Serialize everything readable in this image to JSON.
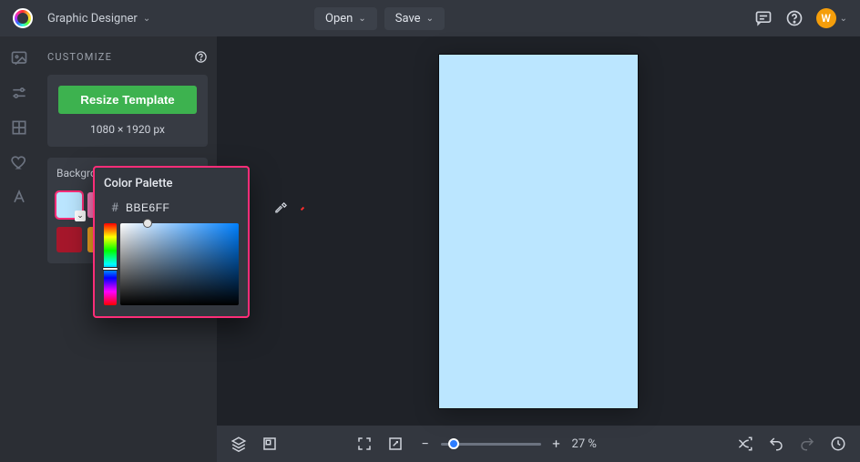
{
  "header": {
    "title": "Graphic Designer",
    "open_label": "Open",
    "save_label": "Save",
    "avatar_letter": "W"
  },
  "rail": {
    "items": [
      "image-icon",
      "sliders-icon",
      "grid-icon",
      "heart-icon",
      "text-icon"
    ]
  },
  "customize": {
    "title": "CUSTOMIZE",
    "resize_label": "Resize Template",
    "dimensions": "1080 × 1920 px",
    "bg_label": "Background Color",
    "swatches_row1": [
      "#bbe6ff",
      "#ff7fbf",
      "#6bbf6b"
    ],
    "swatches_row2": [
      "#a6172b",
      "#f5a623"
    ]
  },
  "palette": {
    "title": "Color Palette",
    "hex": "BBE6FF",
    "current_color": "#bbe6ff"
  },
  "canvas": {
    "artboard_fill": "#bbe6ff"
  },
  "bottombar": {
    "zoom_value": "27 %"
  }
}
